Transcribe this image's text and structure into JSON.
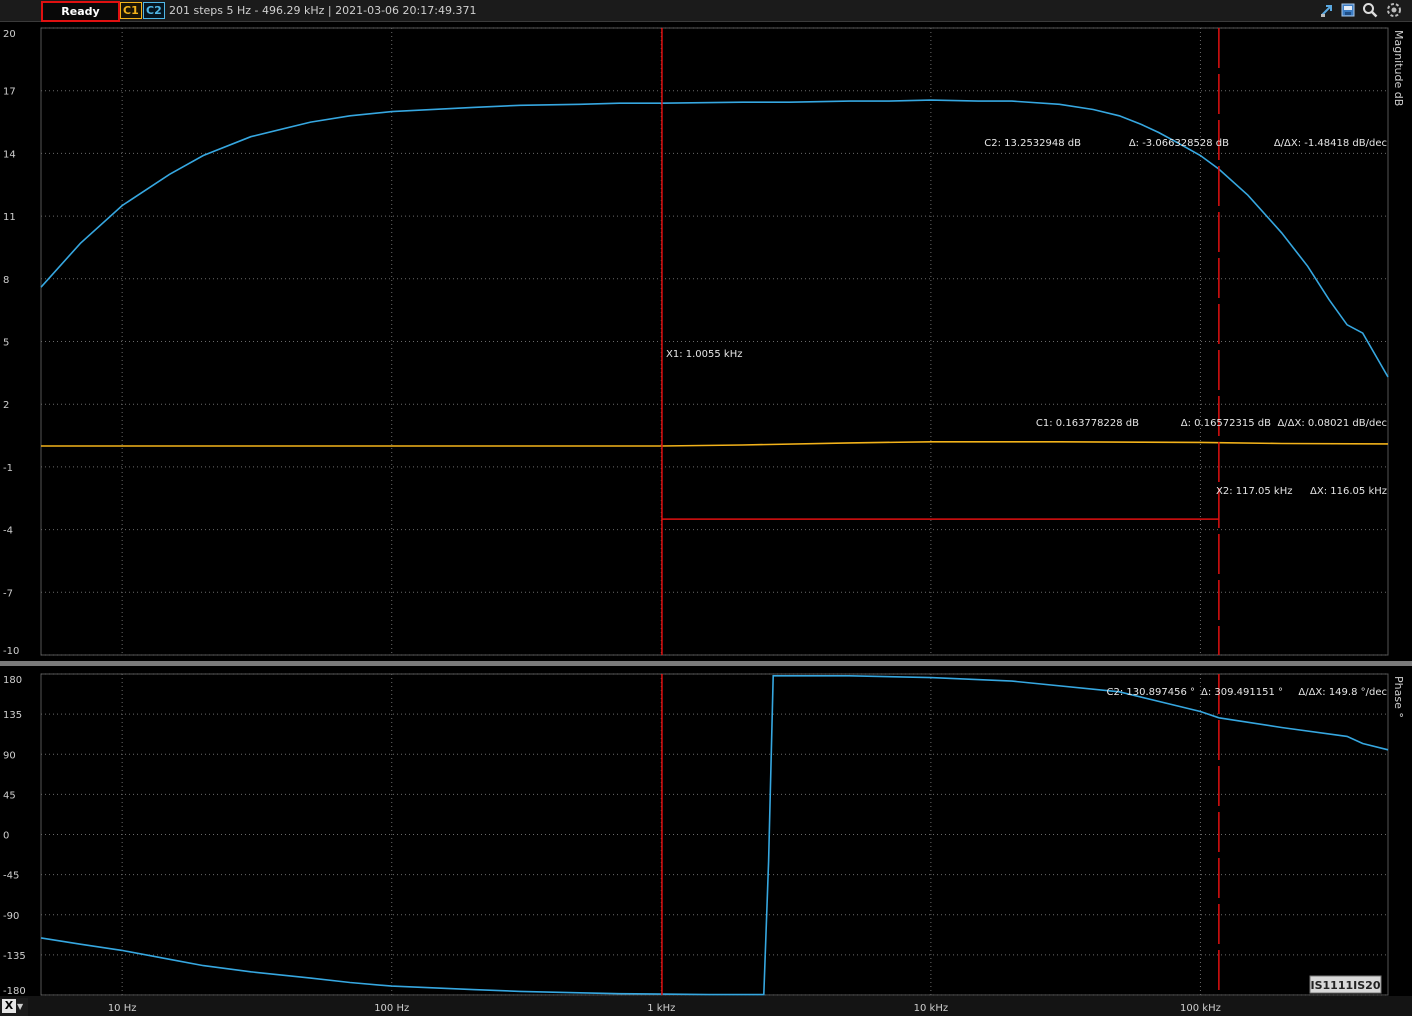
{
  "toolbar": {
    "status": "Ready",
    "channel1": "C1",
    "channel2": "C2",
    "info": "201 steps  5 Hz - 496.29 kHz | 2021-03-06 20:17:49.371",
    "icons": [
      "cursor-icon",
      "export-icon",
      "zoom-icon",
      "settings-icon"
    ]
  },
  "colors": {
    "c1": "#f2b21a",
    "c2": "#36a7e0",
    "cursor": "#e01010",
    "grid": "#6a6a6a"
  },
  "x_axis": {
    "scale": "log",
    "min_hz": 5,
    "max_hz": 496290,
    "ticks": [
      {
        "value": 10,
        "label": "10 Hz"
      },
      {
        "value": 100,
        "label": "100 Hz"
      },
      {
        "value": 1000,
        "label": "1 kHz"
      },
      {
        "value": 10000,
        "label": "10 kHz"
      },
      {
        "value": 100000,
        "label": "100 kHz"
      }
    ],
    "selector": "X"
  },
  "chart_data": [
    {
      "type": "line",
      "ylabel": "Magnitude  dB",
      "ylim": [
        -10,
        20
      ],
      "yticks": [
        20,
        17,
        14,
        11,
        8,
        5,
        2,
        -1,
        -4,
        -7,
        -10
      ],
      "series": [
        {
          "name": "C2",
          "color": "#36a7e0",
          "x": [
            5,
            7,
            10,
            15,
            20,
            30,
            50,
            70,
            100,
            200,
            300,
            500,
            700,
            1000,
            2000,
            3000,
            5000,
            7000,
            10000,
            15000,
            20000,
            30000,
            40000,
            50000,
            60000,
            70000,
            80000,
            100000,
            117050,
            150000,
            200000,
            250000,
            300000,
            350000,
            400000,
            496290
          ],
          "y": [
            7.6,
            9.7,
            11.5,
            13.0,
            13.9,
            14.8,
            15.5,
            15.8,
            16.0,
            16.2,
            16.3,
            16.35,
            16.4,
            16.4,
            16.45,
            16.45,
            16.5,
            16.5,
            16.55,
            16.5,
            16.5,
            16.35,
            16.1,
            15.8,
            15.4,
            15.0,
            14.6,
            13.9,
            13.25,
            12.0,
            10.2,
            8.6,
            7.0,
            5.8,
            5.4,
            3.3
          ]
        },
        {
          "name": "C1",
          "color": "#f2b21a",
          "x": [
            5,
            10,
            100,
            1000,
            2000,
            5000,
            10000,
            30000,
            60000,
            100000,
            117050,
            200000,
            496290
          ],
          "y": [
            0.0,
            0.0,
            0.0,
            0.0,
            0.05,
            0.15,
            0.2,
            0.2,
            0.18,
            0.17,
            0.16,
            0.12,
            0.1
          ]
        }
      ],
      "readouts": {
        "c2_value": "C2: 13.2532948 dB",
        "c2_delta": "Δ: -3.066328528 dB",
        "c2_slope": "Δ/ΔX: -1.48418 dB/dec",
        "c1_value": "C1: 0.163778228 dB",
        "c1_delta": "Δ: 0.16572315 dB",
        "c1_slope": "Δ/ΔX: 0.08021 dB/dec",
        "x1": "X1: 1.0055 kHz",
        "x2": "X2: 117.05 kHz",
        "dx": "ΔX: 116.05 kHz"
      },
      "cursors": {
        "x1_hz": 1005.5,
        "x2_hz": 117050,
        "bracket_level_db": -3.5
      }
    },
    {
      "type": "line",
      "ylabel": "Phase  °",
      "ylim": [
        -180,
        180
      ],
      "yticks": [
        180,
        135,
        90,
        45,
        0,
        -45,
        -90,
        -135,
        -180
      ],
      "series": [
        {
          "name": "C2",
          "color": "#36a7e0",
          "x": [
            5,
            7,
            10,
            15,
            20,
            30,
            50,
            70,
            100,
            200,
            300,
            500,
            700,
            1000,
            1500,
            2000,
            2400,
            2400,
            2500,
            2600,
            5000,
            10000,
            20000,
            50000,
            100000,
            117050,
            200000,
            350000,
            400000,
            496290
          ],
          "y": [
            -116,
            -123,
            -130,
            -140,
            -147,
            -154,
            -161,
            -166,
            -170,
            -174,
            -176,
            -177.5,
            -178.5,
            -179,
            -179.5,
            -179.5,
            -179.5,
            -179.5,
            -30,
            178,
            178,
            176,
            172,
            160,
            138,
            130.9,
            120,
            110,
            102,
            95
          ]
        }
      ],
      "readouts": {
        "c2_value": "C2: 130.897456 °",
        "c2_delta": "Δ: 309.491151 °",
        "c2_slope": "Δ/ΔX: 149.8 °/dec"
      },
      "cursors": {
        "x1_hz": 1005.5,
        "x2_hz": 117050
      }
    }
  ],
  "watermark": "IS1111IS20"
}
